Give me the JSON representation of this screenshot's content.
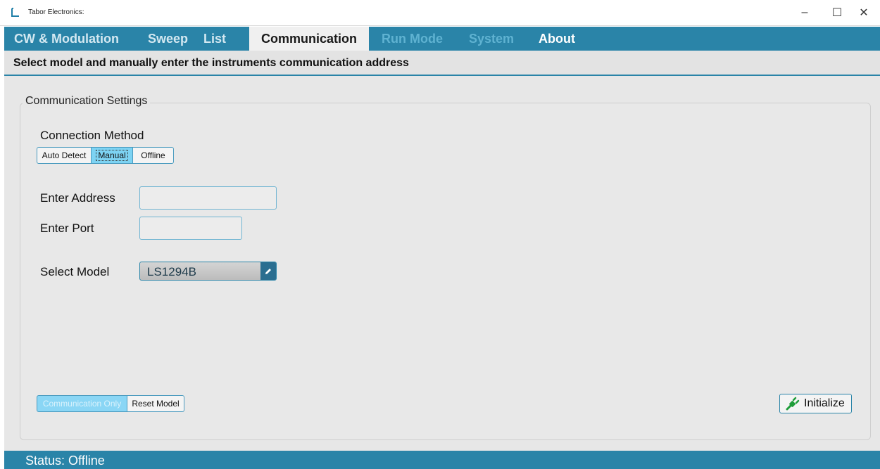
{
  "window": {
    "title": "Tabor Electronics:",
    "app_icon": "tabor-logo-icon",
    "controls": {
      "minimize": "–",
      "maximize": "☐",
      "close": "✕"
    }
  },
  "tabs": [
    {
      "label": "CW & Modulation",
      "state": "normal"
    },
    {
      "label": "Sweep",
      "state": "normal"
    },
    {
      "label": "List",
      "state": "normal"
    },
    {
      "label": "Communication",
      "state": "active"
    },
    {
      "label": "Run Mode",
      "state": "disabled"
    },
    {
      "label": "System",
      "state": "disabled"
    },
    {
      "label": "About",
      "state": "highlight"
    }
  ],
  "banner": {
    "text": "Select model and manually enter the instruments communication address"
  },
  "settings": {
    "group_title": "Communication Settings",
    "connection_method": {
      "label": "Connection Method",
      "options": [
        "Auto Detect",
        "Manual",
        "Offline"
      ],
      "selected": "Manual"
    },
    "address": {
      "label": "Enter Address",
      "value": ""
    },
    "port": {
      "label": "Enter Port",
      "value": ""
    },
    "model": {
      "label": "Select Model",
      "value": "LS1294B",
      "edit_icon": "pencil-icon"
    },
    "bottom_toggle": {
      "options": [
        "Communication Only",
        "Reset Model"
      ],
      "selected": "Communication Only"
    },
    "initialize": {
      "label": "Initialize",
      "icon": "plug-icon"
    }
  },
  "status": {
    "text": "Status: Offline"
  },
  "colors": {
    "accent": "#2a84a8",
    "selected": "#7dd3f3",
    "background": "#e7e7e7"
  }
}
